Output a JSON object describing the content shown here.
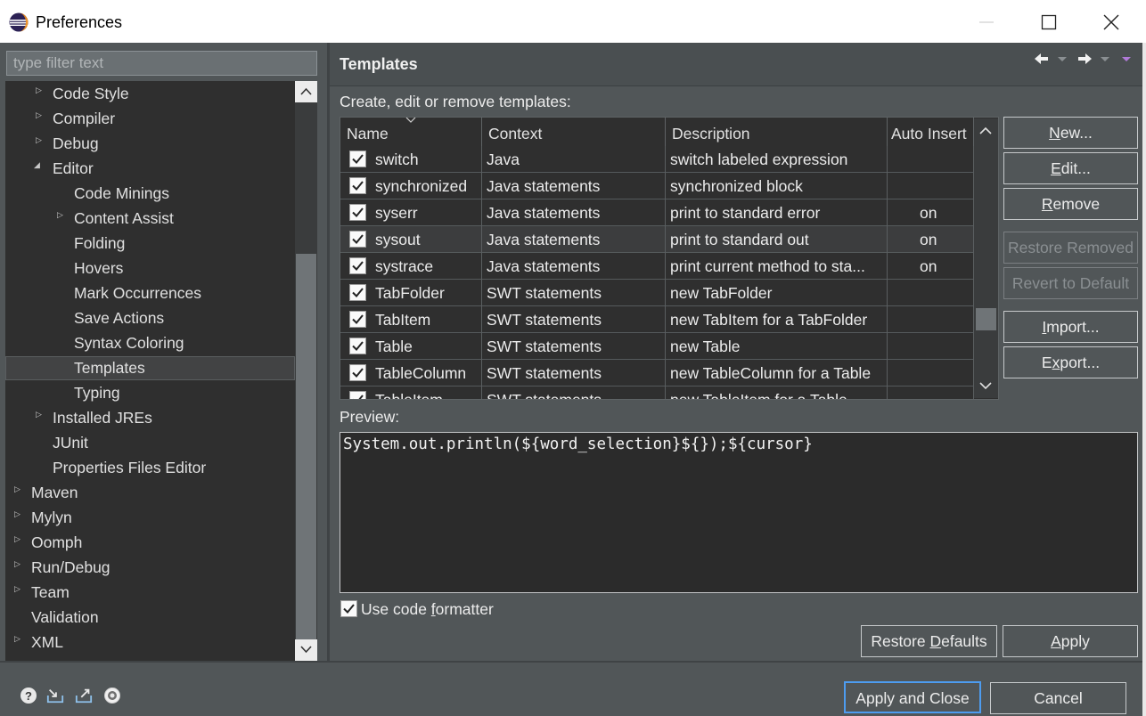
{
  "window": {
    "title": "Preferences"
  },
  "filter": {
    "placeholder": "type filter text"
  },
  "tree": {
    "items": [
      {
        "label": "Code Style",
        "level": 1,
        "arrow": "collapsed"
      },
      {
        "label": "Compiler",
        "level": 1,
        "arrow": "collapsed"
      },
      {
        "label": "Debug",
        "level": 1,
        "arrow": "collapsed"
      },
      {
        "label": "Editor",
        "level": 1,
        "arrow": "expanded"
      },
      {
        "label": "Code Minings",
        "level": 2,
        "arrow": "none"
      },
      {
        "label": "Content Assist",
        "level": 2,
        "arrow": "collapsed"
      },
      {
        "label": "Folding",
        "level": 2,
        "arrow": "none"
      },
      {
        "label": "Hovers",
        "level": 2,
        "arrow": "none"
      },
      {
        "label": "Mark Occurrences",
        "level": 2,
        "arrow": "none"
      },
      {
        "label": "Save Actions",
        "level": 2,
        "arrow": "none"
      },
      {
        "label": "Syntax Coloring",
        "level": 2,
        "arrow": "none"
      },
      {
        "label": "Templates",
        "level": 2,
        "arrow": "none",
        "selected": true
      },
      {
        "label": "Typing",
        "level": 2,
        "arrow": "none"
      },
      {
        "label": "Installed JREs",
        "level": 1,
        "arrow": "collapsed"
      },
      {
        "label": "JUnit",
        "level": 1,
        "arrow": "none"
      },
      {
        "label": "Properties Files Editor",
        "level": 1,
        "arrow": "none"
      },
      {
        "label": "Maven",
        "level": 0,
        "arrow": "collapsed"
      },
      {
        "label": "Mylyn",
        "level": 0,
        "arrow": "collapsed"
      },
      {
        "label": "Oomph",
        "level": 0,
        "arrow": "collapsed"
      },
      {
        "label": "Run/Debug",
        "level": 0,
        "arrow": "collapsed"
      },
      {
        "label": "Team",
        "level": 0,
        "arrow": "collapsed"
      },
      {
        "label": "Validation",
        "level": 0,
        "arrow": "none"
      },
      {
        "label": "XML",
        "level": 0,
        "arrow": "collapsed"
      }
    ]
  },
  "page": {
    "title": "Templates",
    "description": "Create, edit or remove templates:"
  },
  "table": {
    "columns": [
      "Name",
      "Context",
      "Description",
      "Auto Insert"
    ],
    "rows": [
      {
        "checked": true,
        "name": "switch",
        "context": "Java",
        "description": "switch labeled expression",
        "auto": ""
      },
      {
        "checked": true,
        "name": "synchronized",
        "context": "Java statements",
        "description": "synchronized block",
        "auto": ""
      },
      {
        "checked": true,
        "name": "syserr",
        "context": "Java statements",
        "description": "print to standard error",
        "auto": "on"
      },
      {
        "checked": true,
        "name": "sysout",
        "context": "Java statements",
        "description": "print to standard out",
        "auto": "on",
        "selected": true
      },
      {
        "checked": true,
        "name": "systrace",
        "context": "Java statements",
        "description": "print current method to sta...",
        "auto": "on"
      },
      {
        "checked": true,
        "name": "TabFolder",
        "context": "SWT statements",
        "description": "new TabFolder",
        "auto": ""
      },
      {
        "checked": true,
        "name": "TabItem",
        "context": "SWT statements",
        "description": "new TabItem for a TabFolder",
        "auto": ""
      },
      {
        "checked": true,
        "name": "Table",
        "context": "SWT statements",
        "description": "new Table",
        "auto": ""
      },
      {
        "checked": true,
        "name": "TableColumn",
        "context": "SWT statements",
        "description": "new TableColumn for a Table",
        "auto": ""
      },
      {
        "checked": true,
        "name": "TableItem",
        "context": "SWT statements",
        "description": "new TableItem for a Table",
        "auto": ""
      }
    ]
  },
  "side_buttons": {
    "new": {
      "pre": "",
      "u": "N",
      "post": "ew..."
    },
    "edit": {
      "pre": "",
      "u": "E",
      "post": "dit..."
    },
    "remove": {
      "pre": "",
      "u": "R",
      "post": "emove"
    },
    "restore_removed": "Restore Removed",
    "revert_default": "Revert to Default",
    "import": {
      "pre": "",
      "u": "I",
      "post": "mport..."
    },
    "export": {
      "pre": "E",
      "u": "x",
      "post": "port..."
    }
  },
  "preview": {
    "label": "Preview:",
    "code": "System.out.println(${word_selection}${});${cursor}"
  },
  "options": {
    "use_formatter": {
      "pre": "Use code ",
      "u": "f",
      "post": "ormatter",
      "checked": true
    }
  },
  "page_buttons": {
    "restore_defaults": {
      "pre": "Restore ",
      "u": "D",
      "post": "efaults"
    },
    "apply": {
      "pre": "",
      "u": "A",
      "post": "pply"
    }
  },
  "dialog_buttons": {
    "apply_close": "Apply and Close",
    "cancel": "Cancel"
  },
  "bottom_icons": [
    "help-icon",
    "import-icon",
    "export-icon",
    "oomph-icon"
  ],
  "colors": {
    "accent": "#4d9cf0",
    "background": "#515658",
    "tree_bg": "#2f2f2f"
  }
}
